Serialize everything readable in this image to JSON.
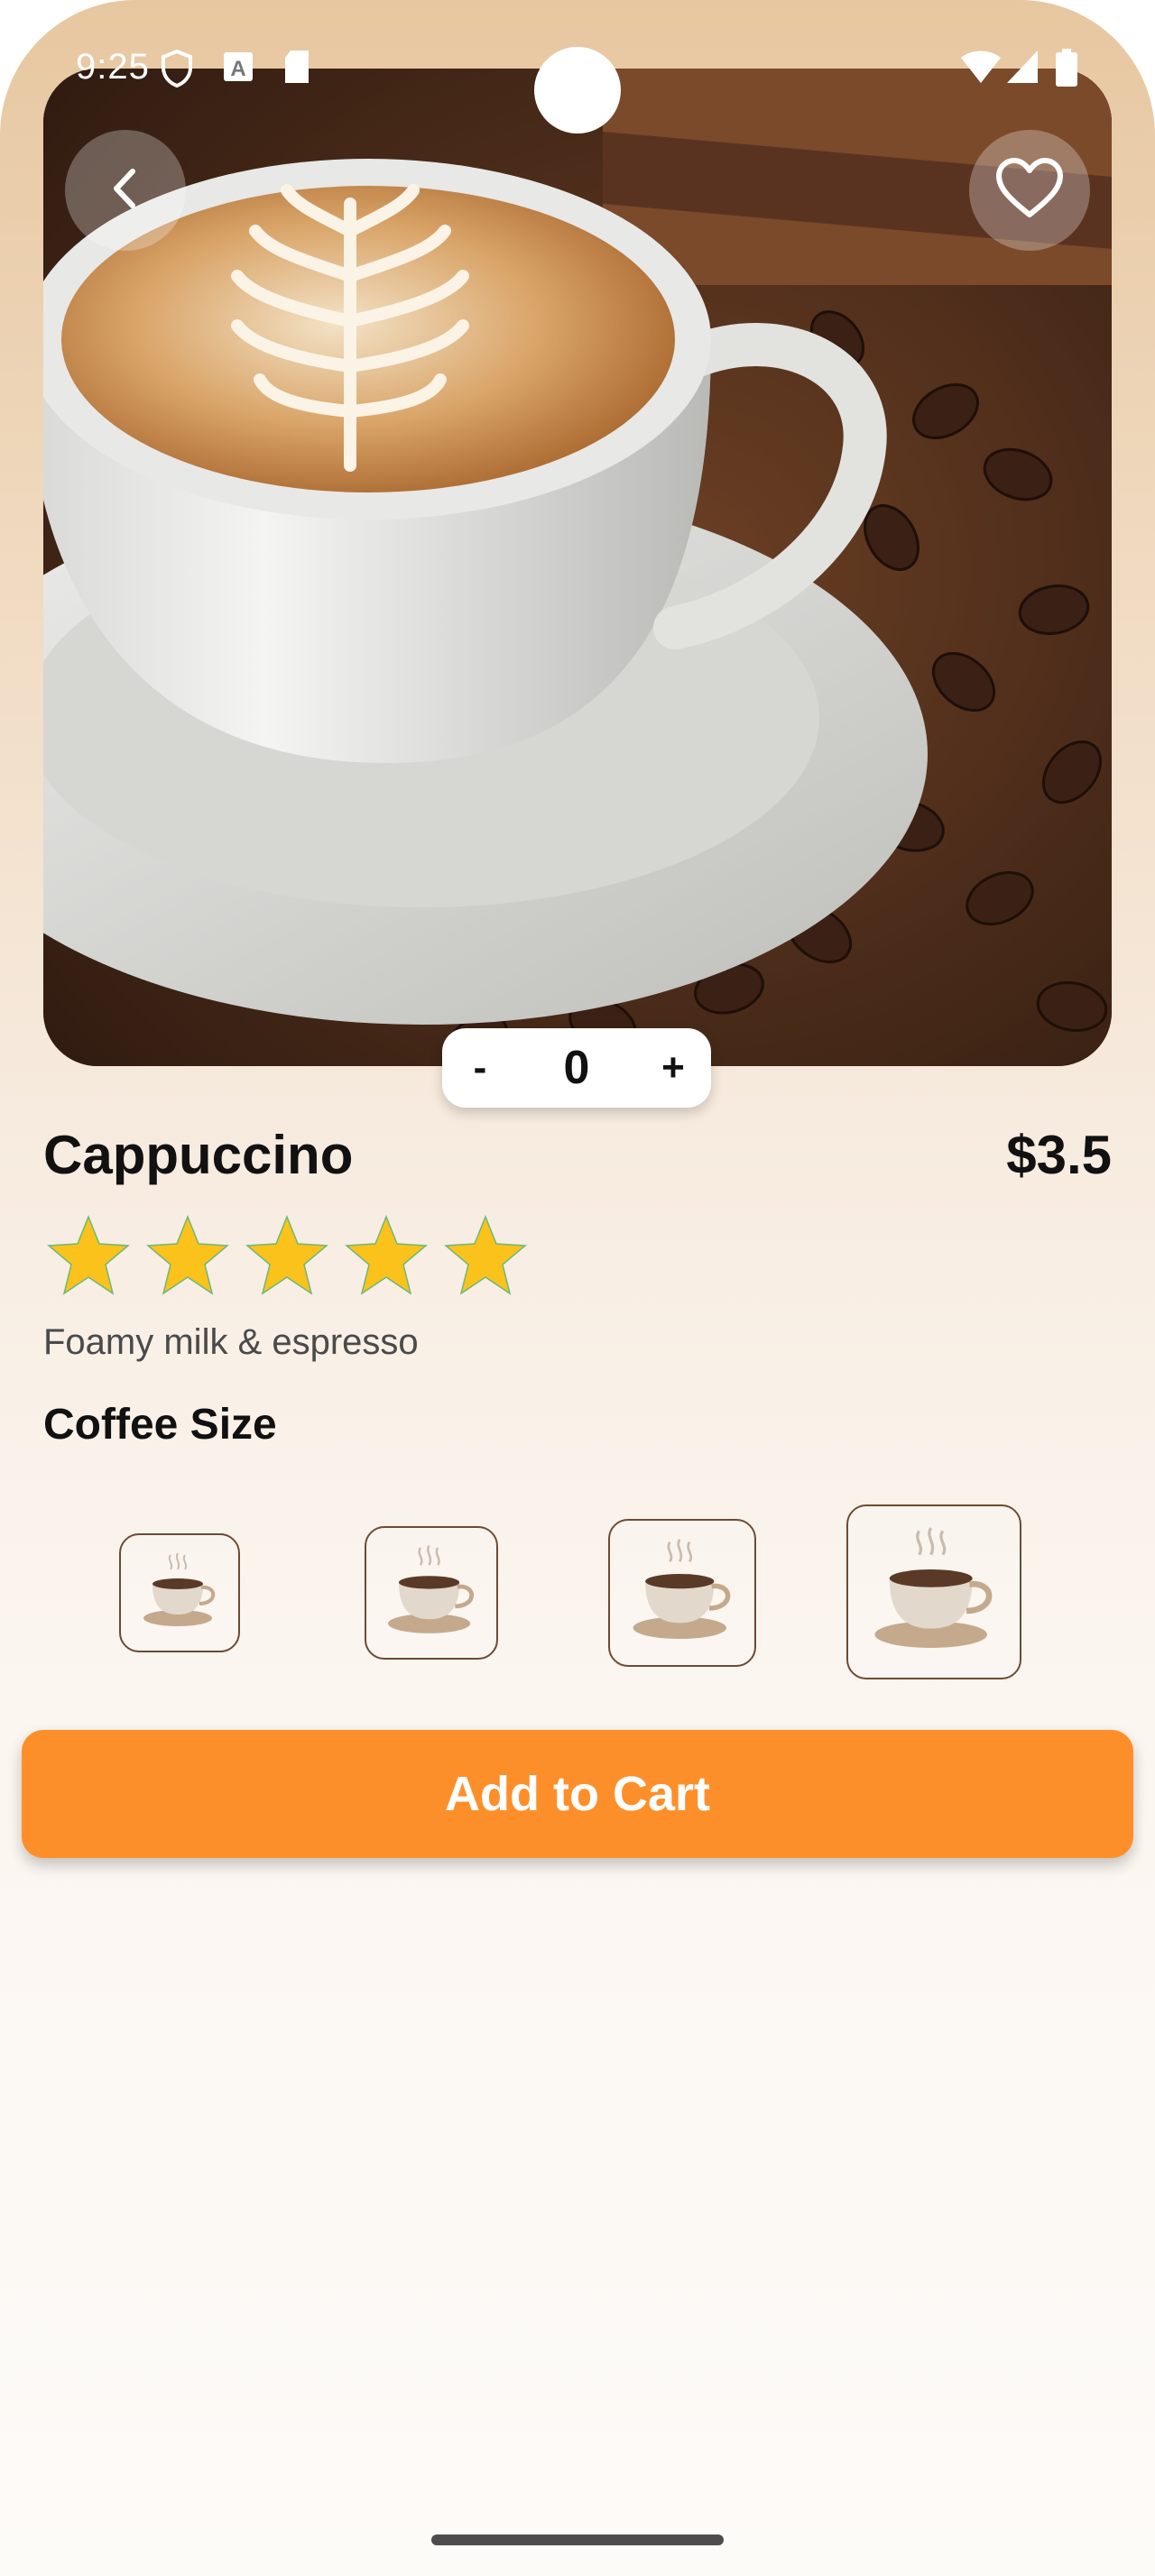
{
  "status_bar": {
    "time": "9:25",
    "icons": [
      "shield-icon",
      "a-badge-icon",
      "sd-card-icon",
      "wifi-icon",
      "signal-icon",
      "battery-icon"
    ]
  },
  "hero": {
    "image": "cappuccino-cup-on-coffee-beans",
    "back_icon": "chevron-left-icon",
    "favorite_icon": "heart-outline-icon"
  },
  "quantity": {
    "minus": "-",
    "value": "0",
    "plus": "+"
  },
  "product": {
    "name": "Cappuccino",
    "price": "$3.5",
    "rating": 5,
    "rating_max": 5,
    "description": "Foamy milk & espresso"
  },
  "size_section": {
    "title": "Coffee Size",
    "options": [
      "cup-small-icon",
      "cup-medium-icon",
      "cup-large-icon",
      "cup-xlarge-icon"
    ]
  },
  "cart": {
    "label": "Add to Cart"
  },
  "colors": {
    "accent": "#fd8f2a",
    "star": "#fbc21c",
    "background_top": "#e7c7a0",
    "background_bottom": "#fdfbf8"
  }
}
